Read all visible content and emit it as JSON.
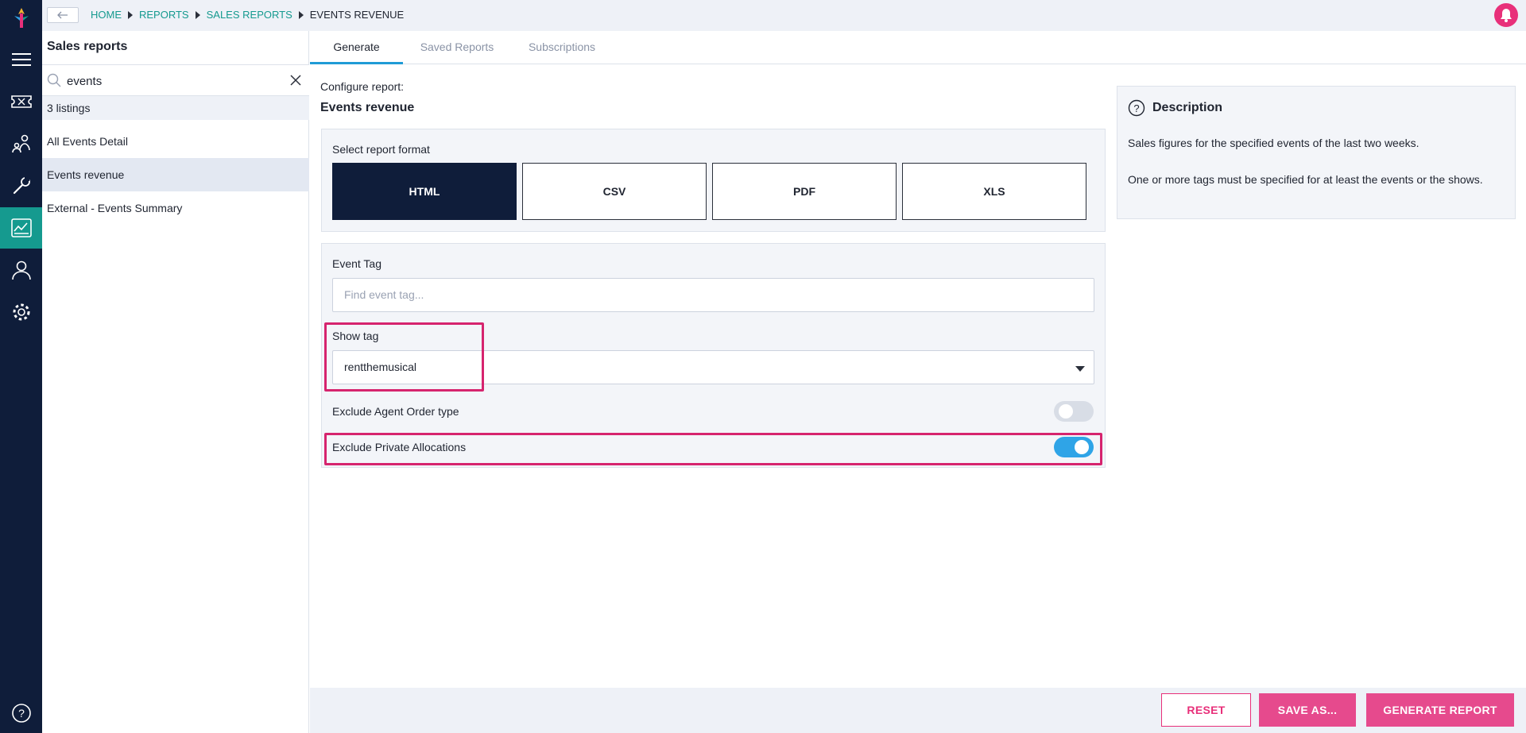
{
  "nav": {
    "items": [
      "menu-icon",
      "tickets-icon",
      "customers-icon",
      "tools-icon",
      "reports-icon",
      "user-icon",
      "settings-icon",
      "help-icon"
    ],
    "active_color": "#159a8f"
  },
  "breadcrumb": {
    "items": [
      "HOME",
      "REPORTS",
      "SALES REPORTS"
    ],
    "current": "EVENTS REVENUE"
  },
  "left_panel": {
    "title": "Sales reports",
    "search_value": "events",
    "count": "3 listings",
    "items": [
      {
        "label": "All Events Detail"
      },
      {
        "label": "Events revenue"
      },
      {
        "label": "External - Events Summary"
      }
    ]
  },
  "tabs": [
    {
      "label": "Generate"
    },
    {
      "label": "Saved Reports"
    },
    {
      "label": "Subscriptions"
    }
  ],
  "config": {
    "label": "Configure report:",
    "title": "Events revenue",
    "format_label": "Select report format",
    "formats": [
      "HTML",
      "CSV",
      "PDF",
      "XLS"
    ],
    "selected_format": "HTML"
  },
  "options": {
    "event_tag_label": "Event Tag",
    "event_tag_placeholder": "Find event tag...",
    "show_tag_label": "Show tag",
    "show_tag_value": "rentthemusical",
    "exclude_agent_label": "Exclude Agent Order type",
    "exclude_agent_on": false,
    "exclude_private_label": "Exclude Private Allocations",
    "exclude_private_on": true
  },
  "description": {
    "title": "Description",
    "p1": "Sales figures for the specified events of the last two weeks.",
    "p2": "One or more tags must be specified for at least the events or the shows."
  },
  "footer": {
    "reset": "RESET",
    "save_as": "SAVE AS...",
    "generate": "GENERATE REPORT"
  },
  "colors": {
    "navy": "#0f1d3a",
    "accent_teal": "#159a8f",
    "pink": "#e64a8d",
    "toggle_blue": "#2fa4e7",
    "highlight": "#d6246e"
  }
}
